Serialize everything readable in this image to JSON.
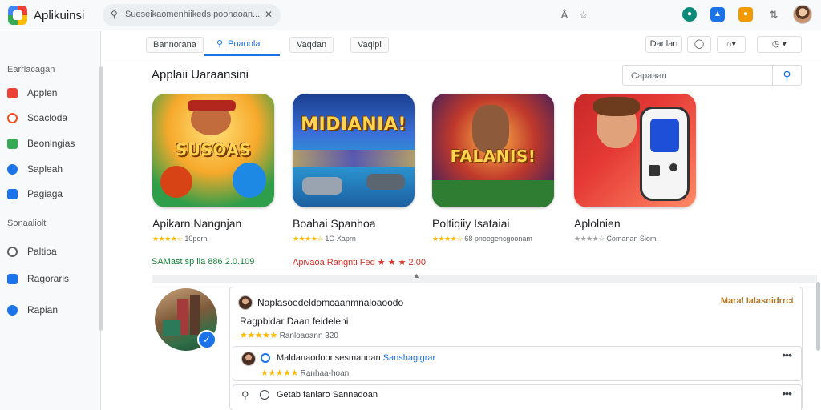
{
  "topbar": {
    "app_title": "Aplikuinsi",
    "search_value": "Sueseikaomenhiikeds.poonaoan...",
    "icons": [
      "search-icon",
      "close-icon",
      "font-icon",
      "star-icon",
      "teal-circle-icon",
      "blue-app-icon",
      "orange-notification-icon",
      "refresh-icon"
    ]
  },
  "sidebar": {
    "heading1": "Earrlacagan",
    "items1": [
      {
        "label": "Applen",
        "color": "#ea4335"
      },
      {
        "label": "Soacloda",
        "color": "#f4511e"
      },
      {
        "label": "Beonlngias",
        "color": "#34a853"
      },
      {
        "label": "Sapleah",
        "color": "#1a73e8"
      },
      {
        "label": "Pagiaga",
        "color": "#1a73e8"
      }
    ],
    "heading2": "Sonaaliolt",
    "items2": [
      {
        "label": "Paltioa",
        "color": "#5f6368"
      },
      {
        "label": "Ragoraris",
        "color": "#1a73e8"
      },
      {
        "label": "Rapian",
        "color": "#1a73e8"
      }
    ]
  },
  "tabs": [
    {
      "label": "Bannorana"
    },
    {
      "label": "Poaoola"
    },
    {
      "label": "Vaqdan"
    },
    {
      "label": "Vaqipi"
    }
  ],
  "toolbar": {
    "button1": "Danlan",
    "button2": "◯",
    "button3": "⌂▾",
    "button4": "◷   ▾"
  },
  "main": {
    "section_title": "Applaii Uaraansini",
    "search_placeholder": "Capaaan"
  },
  "apps": [
    {
      "name": "Apikarn Nangnjan",
      "art": "SUSOAS",
      "rating": "★★★★☆",
      "meta": "10porn",
      "extra": "SAMast sp lia 886 2.0.109",
      "extra_color": "#188038"
    },
    {
      "name": "Boahai Spanhoa",
      "art": "MIDIANIA!",
      "rating": "★★★★☆",
      "meta": "1Ö Xaprn",
      "extra": "Apivaoa Rangnti Fed ★ ★ ★  2.00",
      "extra_color": "#d93025"
    },
    {
      "name": "Poltiqiiy Isataiai",
      "art": "FALANIS!",
      "rating": "★★★★☆",
      "meta": "68 pnoogencgoonam",
      "extra": "",
      "extra_color": "#5f6368"
    },
    {
      "name": "Aplolnien",
      "art": "",
      "rating": "★★★★☆",
      "meta": "Comanan Siom",
      "extra": "",
      "extra_color": "#5f6368"
    }
  ],
  "review": {
    "author": "Naplasoedeldomcaanmnaloaoodo",
    "title": "Ragpbidar Daan feideleni",
    "stars": "★★★★★",
    "meta": "Ranloaoann 320",
    "tag": "Maral Ialasnidrrct",
    "reply1_author": "Maldanaodoonsesmanoan",
    "reply1_link": "Sanshagigrar",
    "reply1_stars": "★★★★★",
    "reply1_meta": "Ranhaa-hoan",
    "reply2_text": "Getab fanlaro Sannadoan",
    "more": "•••"
  }
}
